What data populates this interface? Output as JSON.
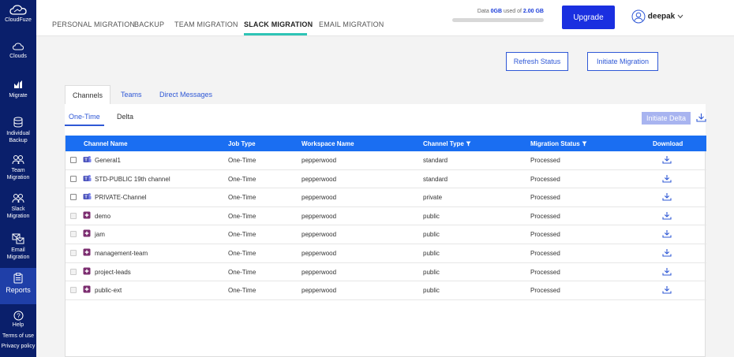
{
  "sidebar": {
    "logo_label": "CloudFuze",
    "items": [
      {
        "label": "Clouds",
        "icon": "cloud-icon"
      },
      {
        "label": "Migrate",
        "icon": "migrate-icon"
      },
      {
        "label": "Individual Backup",
        "icon": "database-icon"
      },
      {
        "label": "Team Migration",
        "icon": "team-icon"
      },
      {
        "label": "Slack Migration",
        "icon": "users-icon"
      },
      {
        "label": "Email Migration",
        "icon": "email-icon"
      }
    ],
    "reports_label": "Reports",
    "help_label": "Help",
    "terms_label": "Terms of use",
    "privacy_label": "Privacy policy"
  },
  "topnav": {
    "tabs": [
      "PERSONAL MIGRATION",
      "BACKUP",
      "TEAM MIGRATION",
      "SLACK MIGRATION",
      "EMAIL MIGRATION"
    ],
    "active_tab": "SLACK MIGRATION",
    "storage_prefix": "Data ",
    "storage_used": "0GB",
    "storage_middle": " used of ",
    "storage_total": "2.00 GB",
    "storage_progress": 0,
    "upgrade_label": "Upgrade",
    "username": "deepak"
  },
  "actions": {
    "refresh_label": "Refresh Status",
    "initiate_label": "Initiate Migration"
  },
  "channel_tabs": [
    "Channels",
    "Teams",
    "Direct Messages"
  ],
  "sub_tabs": [
    "One-Time",
    "Delta"
  ],
  "initiate_delta_label": "Initiate Delta",
  "table": {
    "headers": [
      "Channel Name",
      "Job Type",
      "Workspace Name",
      "Channel Type",
      "Migration Status",
      "Download"
    ],
    "rows": [
      {
        "name": "General1",
        "job": "One-Time",
        "workspace": "pepperwood",
        "type": "standard",
        "status": "Processed",
        "icon": "teams-icon"
      },
      {
        "name": "STD-PUBLIC 19th channel",
        "job": "One-Time",
        "workspace": "pepperwood",
        "type": "standard",
        "status": "Processed",
        "icon": "teams-icon"
      },
      {
        "name": "PRIVATE-Channel",
        "job": "One-Time",
        "workspace": "pepperwood",
        "type": "private",
        "status": "Processed",
        "icon": "teams-icon"
      },
      {
        "name": "demo",
        "job": "One-Time",
        "workspace": "pepperwood",
        "type": "public",
        "status": "Processed",
        "icon": "slack-icon"
      },
      {
        "name": "jam",
        "job": "One-Time",
        "workspace": "pepperwood",
        "type": "public",
        "status": "Processed",
        "icon": "slack-icon"
      },
      {
        "name": "management-team",
        "job": "One-Time",
        "workspace": "pepperwood",
        "type": "public",
        "status": "Processed",
        "icon": "slack-icon"
      },
      {
        "name": "project-leads",
        "job": "One-Time",
        "workspace": "pepperwood",
        "type": "public",
        "status": "Processed",
        "icon": "slack-icon"
      },
      {
        "name": "public-ext",
        "job": "One-Time",
        "workspace": "pepperwood",
        "type": "public",
        "status": "Processed",
        "icon": "slack-icon"
      }
    ]
  },
  "colors": {
    "sidebar_bg": "#0a1f6b",
    "accent": "#1a2fe0",
    "table_header": "#1a6ef2",
    "tab_underline": "#2ec4b6"
  }
}
